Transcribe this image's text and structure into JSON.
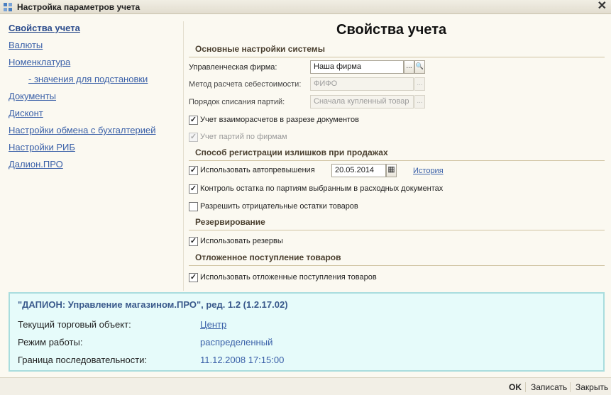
{
  "window": {
    "title": "Настройка параметров учета",
    "close_glyph": "✕"
  },
  "nav": {
    "items": [
      {
        "label": "Свойства учета"
      },
      {
        "label": "Валюты"
      },
      {
        "label": "Номенклатура"
      },
      {
        "label": "- значения для подстановки"
      },
      {
        "label": "Документы"
      },
      {
        "label": "Дисконт"
      },
      {
        "label": "Настройки обмена с бухгалтерией"
      },
      {
        "label": "Настройки РИБ"
      },
      {
        "label": "Далион.ПРО"
      }
    ]
  },
  "main": {
    "heading": "Свойства учета",
    "sections": {
      "basic": "Основные настройки системы",
      "surplus": "Способ регистрации излишков при продажах",
      "reserve": "Резервирование",
      "deferred": "Отложенное поступление товаров"
    },
    "fields": {
      "firm": {
        "label": "Управленческая фирма:",
        "value": "Наша фирма"
      },
      "cost_method": {
        "label": "Метод расчета себестоимости:",
        "value": "ФИФО"
      },
      "batch_order": {
        "label": "Порядок списания партий:",
        "value": "Сначала купленный товар"
      }
    },
    "checks": {
      "settlements": {
        "label": "Учет взаиморасчетов в разрезе документов",
        "checked": true
      },
      "batches_by_firm": {
        "label": "Учет партий по фирмам",
        "checked": true
      },
      "auto_excess": {
        "label": "Использовать автопревышения",
        "checked": true
      },
      "remain_control": {
        "label": "Контроль остатка по партиям выбранным в расходных документах",
        "checked": true
      },
      "negative": {
        "label": "Разрешить отрицательные остатки товаров",
        "checked": false
      },
      "use_reserves": {
        "label": "Использовать резервы",
        "checked": true
      },
      "use_deferred": {
        "label": "Использовать отложенные поступления товаров",
        "checked": true
      }
    },
    "auto_excess_date": "20.05.2014",
    "history_link": "История",
    "check_glyph": "✓",
    "ellipsis": "...",
    "search_glyph": "🔍",
    "calendar_glyph": "▦"
  },
  "info": {
    "product": "\"ДАПИОН: Управление магазином.ПРО\", ред. 1.2 (1.2.17.02)",
    "rows": [
      {
        "key": "Текущий торговый объект:",
        "value": "Центр"
      },
      {
        "key": "Режим работы:",
        "value": "распределенный"
      },
      {
        "key": "Граница последовательности:",
        "value": "11.12.2008 17:15:00"
      }
    ]
  },
  "buttons": {
    "ok": "OK",
    "save": "Записать",
    "close": "Закрыть"
  },
  "colors": {
    "link": "#3a60a8",
    "info_bg": "#e6fbfa",
    "info_border": "#a9ddde",
    "window_bg": "#fbf9f1"
  }
}
